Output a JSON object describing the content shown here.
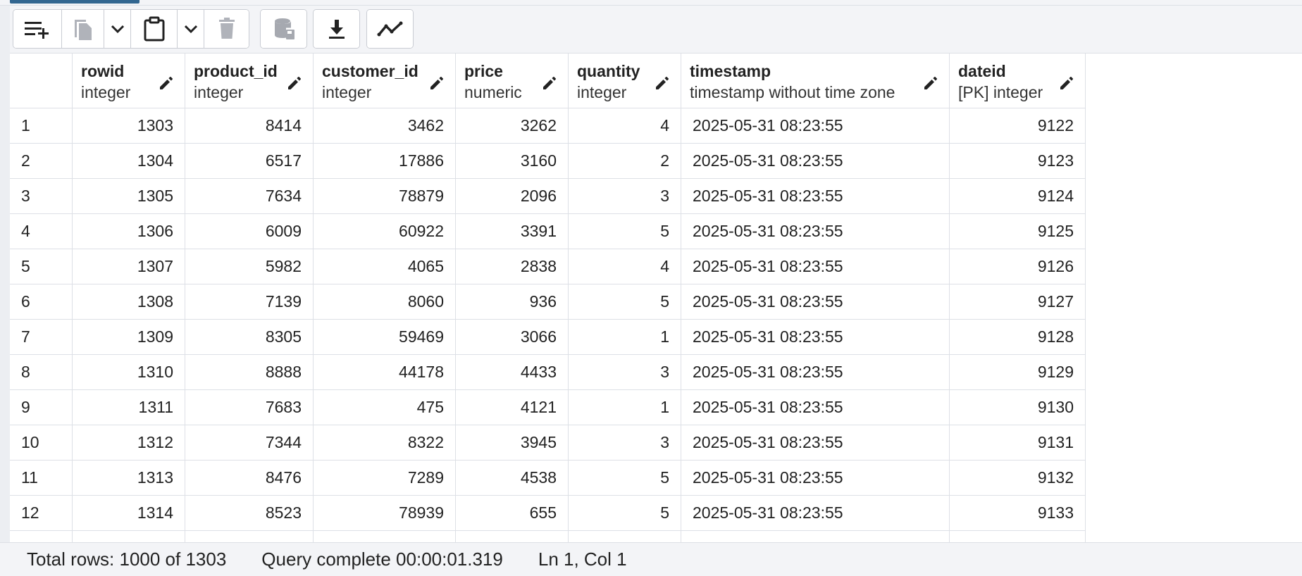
{
  "toolbar": {
    "buttons": [
      {
        "name": "add-row",
        "icon": "add-row-icon"
      },
      {
        "name": "copy",
        "icon": "copy-icon"
      },
      {
        "name": "copy-options",
        "icon": "chevron-down-icon"
      },
      {
        "name": "paste",
        "icon": "paste-icon"
      },
      {
        "name": "paste-options",
        "icon": "chevron-down-icon"
      },
      {
        "name": "delete",
        "icon": "trash-icon"
      },
      {
        "name": "save-data",
        "icon": "database-save-icon"
      },
      {
        "name": "download",
        "icon": "download-icon"
      },
      {
        "name": "graph",
        "icon": "graph-icon"
      }
    ]
  },
  "grid": {
    "columns": [
      {
        "name": "rowid",
        "type": "integer"
      },
      {
        "name": "product_id",
        "type": "integer"
      },
      {
        "name": "customer_id",
        "type": "integer"
      },
      {
        "name": "price",
        "type": "numeric"
      },
      {
        "name": "quantity",
        "type": "integer"
      },
      {
        "name": "timestamp",
        "type": "timestamp without time zone"
      },
      {
        "name": "dateid",
        "type": "[PK] integer"
      }
    ],
    "rows": [
      {
        "n": "1",
        "v": [
          "1303",
          "8414",
          "3462",
          "3262",
          "4",
          "2025-05-31 08:23:55",
          "9122"
        ]
      },
      {
        "n": "2",
        "v": [
          "1304",
          "6517",
          "17886",
          "3160",
          "2",
          "2025-05-31 08:23:55",
          "9123"
        ]
      },
      {
        "n": "3",
        "v": [
          "1305",
          "7634",
          "78879",
          "2096",
          "3",
          "2025-05-31 08:23:55",
          "9124"
        ]
      },
      {
        "n": "4",
        "v": [
          "1306",
          "6009",
          "60922",
          "3391",
          "5",
          "2025-05-31 08:23:55",
          "9125"
        ]
      },
      {
        "n": "5",
        "v": [
          "1307",
          "5982",
          "4065",
          "2838",
          "4",
          "2025-05-31 08:23:55",
          "9126"
        ]
      },
      {
        "n": "6",
        "v": [
          "1308",
          "7139",
          "8060",
          "936",
          "5",
          "2025-05-31 08:23:55",
          "9127"
        ]
      },
      {
        "n": "7",
        "v": [
          "1309",
          "8305",
          "59469",
          "3066",
          "1",
          "2025-05-31 08:23:55",
          "9128"
        ]
      },
      {
        "n": "8",
        "v": [
          "1310",
          "8888",
          "44178",
          "4433",
          "3",
          "2025-05-31 08:23:55",
          "9129"
        ]
      },
      {
        "n": "9",
        "v": [
          "1311",
          "7683",
          "475",
          "4121",
          "1",
          "2025-05-31 08:23:55",
          "9130"
        ]
      },
      {
        "n": "10",
        "v": [
          "1312",
          "7344",
          "8322",
          "3945",
          "3",
          "2025-05-31 08:23:55",
          "9131"
        ]
      },
      {
        "n": "11",
        "v": [
          "1313",
          "8476",
          "7289",
          "4538",
          "5",
          "2025-05-31 08:23:55",
          "9132"
        ]
      },
      {
        "n": "12",
        "v": [
          "1314",
          "8523",
          "78939",
          "655",
          "5",
          "2025-05-31 08:23:55",
          "9133"
        ]
      },
      {
        "n": "",
        "v": [
          "",
          "",
          "",
          "",
          "",
          "",
          ""
        ]
      }
    ]
  },
  "status": {
    "total_rows": "Total rows: 1000 of 1303",
    "query": "Query complete 00:00:01.319",
    "cursor": "Ln 1, Col 1"
  },
  "colors": {
    "accent": "#326690",
    "border": "#dde0e6",
    "toolbar_bg": "#f3f4f7"
  }
}
